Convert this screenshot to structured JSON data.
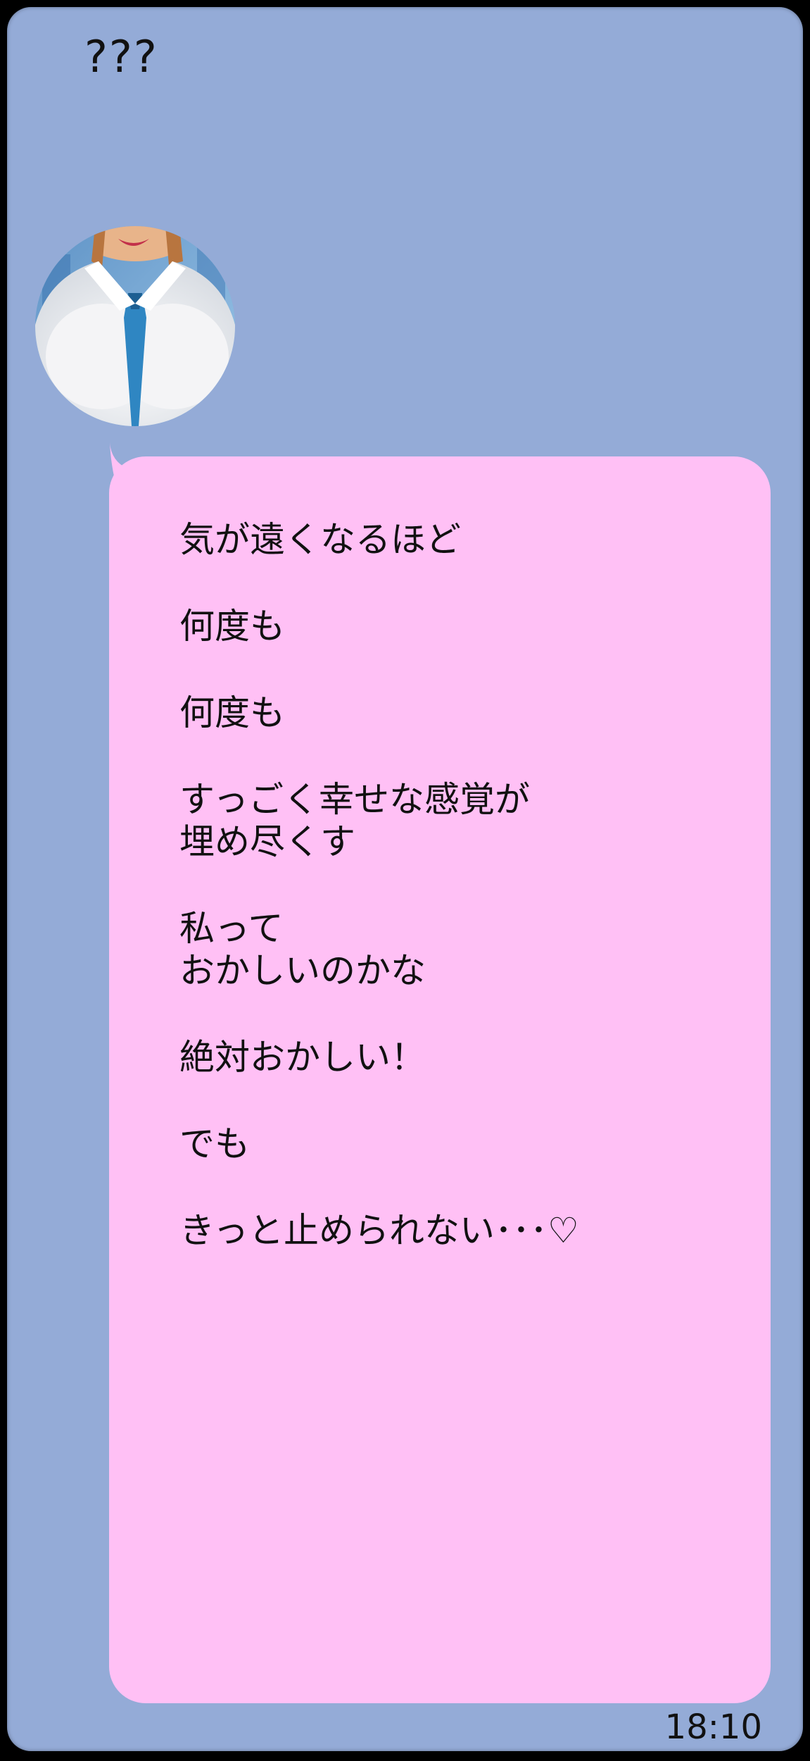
{
  "header": {
    "sender_name": "???"
  },
  "avatar": {
    "icon": "contact-avatar-photo"
  },
  "message": {
    "blocks": [
      {
        "lines": [
          "気が遠くなるほど"
        ]
      },
      {
        "lines": [
          "何度も"
        ]
      },
      {
        "lines": [
          "何度も"
        ]
      },
      {
        "lines": [
          "すっごく幸せな感覚が",
          "埋め尽くす"
        ]
      },
      {
        "lines": [
          "私って",
          "おかしいのかな"
        ]
      },
      {
        "lines": [
          "絶対おかしい！"
        ]
      },
      {
        "lines": [
          "でも"
        ]
      },
      {
        "lines": [
          "きっと止められない･･･♡"
        ]
      }
    ],
    "timestamp": "18:10"
  },
  "colors": {
    "background": "#94abd7",
    "bubble": "#ffc0f5",
    "frame": "#000000",
    "text": "#111111"
  }
}
